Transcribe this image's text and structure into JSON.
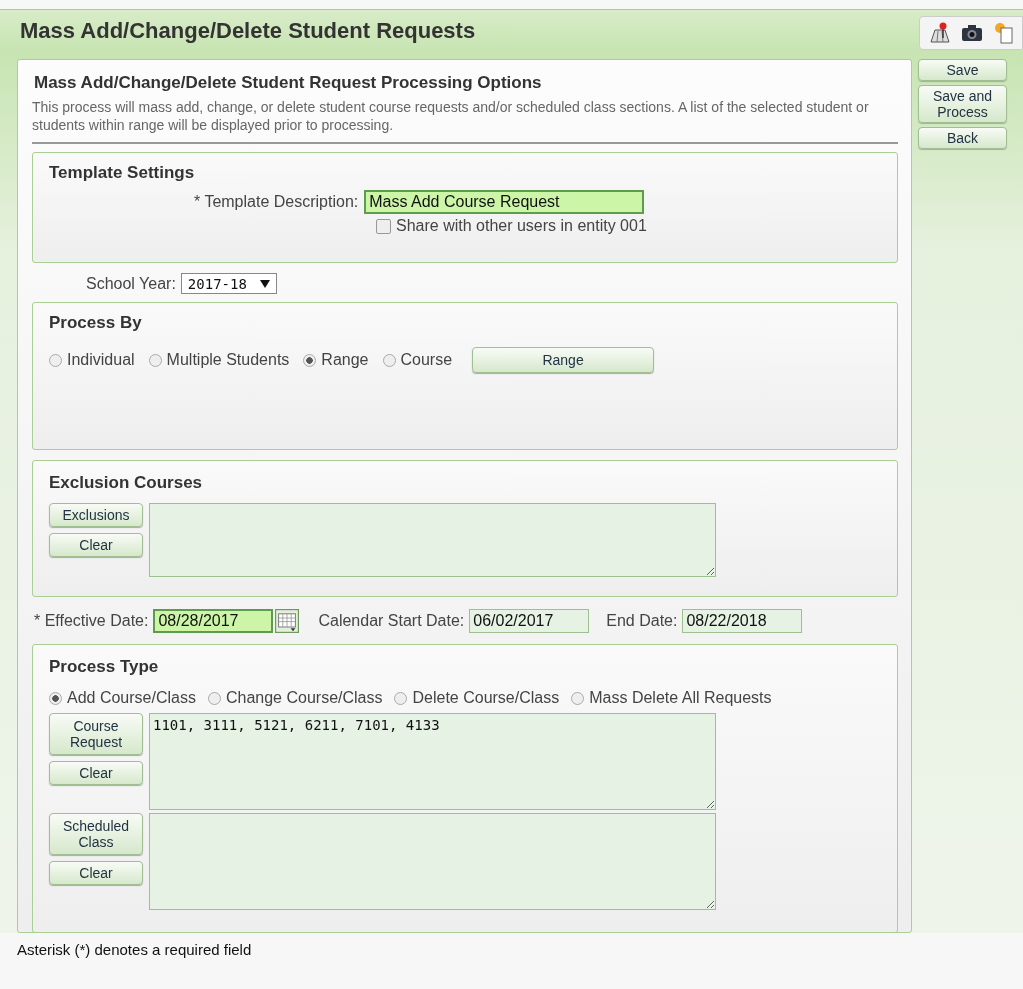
{
  "header": {
    "title": "Mass Add/Change/Delete Student Requests"
  },
  "side_buttons": [
    {
      "label": "Save"
    },
    {
      "label": "Save and Process"
    },
    {
      "label": "Back"
    }
  ],
  "options": {
    "title": "Mass Add/Change/Delete Student Request Processing Options",
    "description": "This process will mass add, change, or delete student course requests and/or scheduled class sections. A list of the selected student or students within range will be displayed prior to processing."
  },
  "template_settings": {
    "title": "Template Settings",
    "description_label": "* Template Description:",
    "description_value": "Mass Add Course Request",
    "share": {
      "label": "Share with other users in entity 001",
      "checked": false
    }
  },
  "school_year": {
    "label": "School Year:",
    "value": "2017-18"
  },
  "process_by": {
    "title": "Process By",
    "options": [
      {
        "label": "Individual",
        "selected": false
      },
      {
        "label": "Multiple Students",
        "selected": false
      },
      {
        "label": "Range",
        "selected": true
      },
      {
        "label": "Course",
        "selected": false
      }
    ],
    "button": "Range"
  },
  "exclusion_courses": {
    "title": "Exclusion Courses",
    "buttons": [
      "Exclusions",
      "Clear"
    ]
  },
  "dates": [
    {
      "label": "* Effective Date:",
      "value": "08/28/2017",
      "kind": "required"
    },
    {
      "label": "Calendar Start Date:",
      "value": "06/02/2017",
      "kind": "readonly"
    },
    {
      "label": "End Date:",
      "value": "08/22/2018",
      "kind": "readonly"
    }
  ],
  "process_type": {
    "title": "Process Type",
    "options": [
      {
        "label": "Add Course/Class",
        "selected": true
      },
      {
        "label": "Change Course/Class",
        "selected": false
      },
      {
        "label": "Delete Course/Class",
        "selected": false
      },
      {
        "label": "Mass Delete All Requests",
        "selected": false
      }
    ],
    "lists": [
      {
        "buttons": [
          "Course Request",
          "Clear"
        ],
        "value": "1101, 3111, 5121, 6211, 7101, 4133"
      },
      {
        "buttons": [
          "Scheduled Class",
          "Clear"
        ]
      }
    ]
  },
  "footer": "Asterisk (*) denotes a required field"
}
